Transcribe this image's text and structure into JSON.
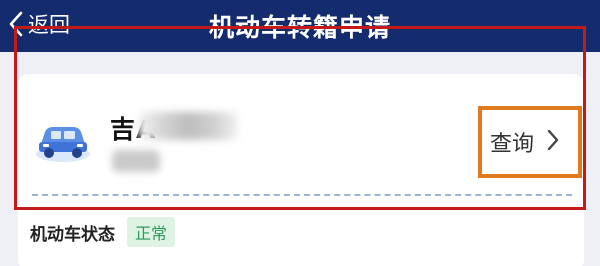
{
  "header": {
    "back_label": "返回",
    "title": "机动车转籍申请",
    "background_color": "#142b6e"
  },
  "vehicle": {
    "plate_prefix": "吉A",
    "query_label": "查询",
    "icon": "car-icon"
  },
  "status": {
    "label": "机动车状态",
    "value": "正常",
    "badge_color": "#2f9a5a"
  },
  "highlights": {
    "card_outline_color": "#c41a1a",
    "query_outline_color": "#e07a1f"
  }
}
